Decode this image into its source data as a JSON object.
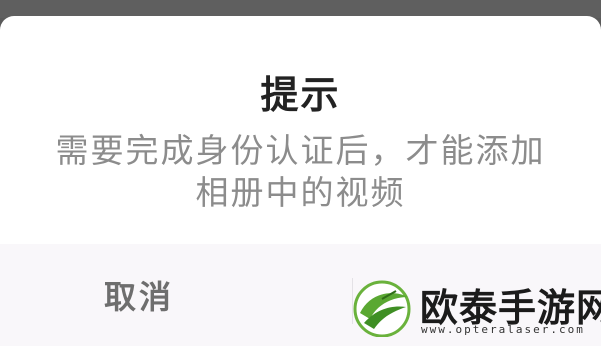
{
  "dialog": {
    "title": "提示",
    "message_line1": "需要完成身份认证后，才能添加",
    "message_line2": "相册中的视频",
    "cancel_label": "取消",
    "confirm_label": ""
  },
  "watermark": {
    "brand_text": "欧泰手游网",
    "url_text": "www.opteralaser.com",
    "logo": "green-leaf-logo"
  },
  "colors": {
    "overlay": "#5a5a5a",
    "dialog_bg": "#ffffff",
    "button_bar_bg": "#f9f7fa",
    "title": "#222222",
    "message": "#8c8c8c",
    "cancel_text": "#6e6e6e",
    "logo_green": "#5aa832"
  }
}
